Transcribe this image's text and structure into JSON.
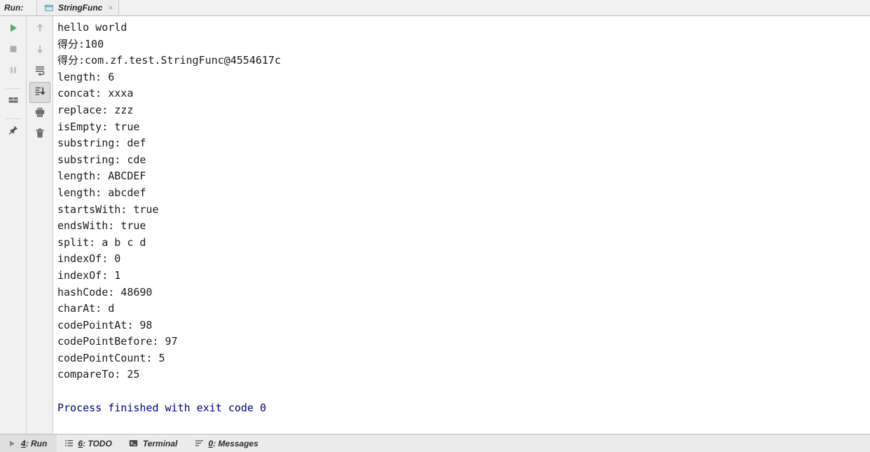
{
  "window": {
    "run_label": "Run:"
  },
  "tab": {
    "title": "StringFunc",
    "close": "×",
    "icon": "run-configuration-icon"
  },
  "toolbar_left": {
    "items": [
      {
        "name": "rerun-button",
        "icon": "play-icon",
        "label": "Rerun"
      },
      {
        "name": "stop-button",
        "icon": "stop-square-icon",
        "label": "Stop"
      },
      {
        "name": "pause-button",
        "icon": "pause-icon",
        "label": "Pause Output"
      },
      {
        "name": "layout-button",
        "icon": "layout-grid-icon",
        "label": "Layout Settings"
      },
      {
        "name": "pin-tab-button",
        "icon": "pin-icon",
        "label": "Pin Tab"
      }
    ]
  },
  "toolbar_right": {
    "items": [
      {
        "name": "up-button",
        "icon": "arrow-up-icon",
        "label": "Up the Stack Trace"
      },
      {
        "name": "down-button",
        "icon": "arrow-down-icon",
        "label": "Down the Stack Trace"
      },
      {
        "name": "soft-wrap-button",
        "icon": "soft-wrap-icon",
        "label": "Use Soft Wraps"
      },
      {
        "name": "scroll-to-end-button",
        "icon": "scroll-to-end-icon",
        "label": "Scroll to End",
        "selected": true
      },
      {
        "name": "print-button",
        "icon": "print-icon",
        "label": "Print"
      },
      {
        "name": "clear-all-button",
        "icon": "trash-icon",
        "label": "Clear All"
      }
    ]
  },
  "console": {
    "lines": [
      {
        "text": "hello world",
        "style": "normal"
      },
      {
        "text": "得分:100",
        "style": "normal"
      },
      {
        "text": "得分:com.zf.test.StringFunc@4554617c",
        "style": "normal"
      },
      {
        "text": "length: 6",
        "style": "normal"
      },
      {
        "text": "concat: xxxa",
        "style": "normal"
      },
      {
        "text": "replace: zzz",
        "style": "normal"
      },
      {
        "text": "isEmpty: true",
        "style": "normal"
      },
      {
        "text": "substring: def",
        "style": "normal"
      },
      {
        "text": "substring: cde",
        "style": "normal"
      },
      {
        "text": "length: ABCDEF",
        "style": "normal"
      },
      {
        "text": "length: abcdef",
        "style": "normal"
      },
      {
        "text": "startsWith: true",
        "style": "normal"
      },
      {
        "text": "endsWith: true",
        "style": "normal"
      },
      {
        "text": "split: a b c d",
        "style": "normal"
      },
      {
        "text": "indexOf: 0",
        "style": "normal"
      },
      {
        "text": "indexOf: 1",
        "style": "normal"
      },
      {
        "text": "hashCode: 48690",
        "style": "normal"
      },
      {
        "text": "charAt: d",
        "style": "normal"
      },
      {
        "text": "codePointAt: 98",
        "style": "normal"
      },
      {
        "text": "codePointBefore: 97",
        "style": "normal"
      },
      {
        "text": "codePointCount: 5",
        "style": "normal"
      },
      {
        "text": "compareTo: 25",
        "style": "normal"
      },
      {
        "text": " ",
        "style": "blank"
      },
      {
        "text": "Process finished with exit code 0",
        "style": "blue"
      }
    ]
  },
  "statusbar": {
    "items": [
      {
        "name": "status-run",
        "num": "4",
        "label": ": Run",
        "icon": "play-icon",
        "active": true
      },
      {
        "name": "status-todo",
        "num": "6",
        "label": ": TODO",
        "icon": "todo-list-icon",
        "active": false
      },
      {
        "name": "status-terminal",
        "num": "",
        "label": "Terminal",
        "icon": "terminal-icon",
        "active": false
      },
      {
        "name": "status-messages",
        "num": "0",
        "label": ": Messages",
        "icon": "messages-icon",
        "active": false
      }
    ]
  },
  "colors": {
    "console_text": "#1b1b1b",
    "exit_message": "#000080",
    "toolbar_bg": "#f1f1f1",
    "statusbar_bg": "#ebebeb",
    "accent_green": "#59a869"
  }
}
